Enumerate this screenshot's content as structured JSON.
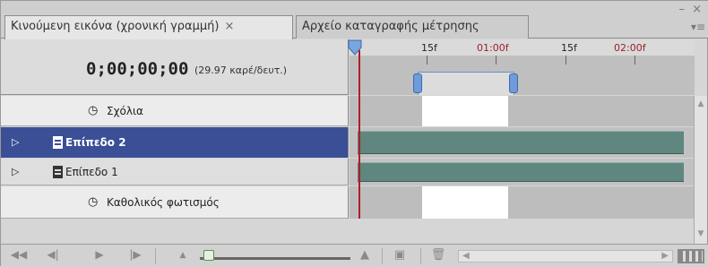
{
  "tabs": [
    {
      "label": "Κινούμενη εικόνα (χρονική γραμμή)",
      "close": "×"
    },
    {
      "label": "Αρχείο καταγραφής μέτρησης"
    }
  ],
  "window_controls": "– ×",
  "panel_menu": "▾≡",
  "header": {
    "timecode": "0;00;00;00",
    "fps": "(29.97 καρέ/δευτ.)"
  },
  "ruler": {
    "labels": [
      {
        "text": "15f",
        "type": "frames"
      },
      {
        "text": "01:00f",
        "type": "secs"
      },
      {
        "text": "15f",
        "type": "frames"
      },
      {
        "text": "02:00f",
        "type": "secs"
      }
    ]
  },
  "layers": [
    {
      "name": "Σχόλια",
      "kind": "global"
    },
    {
      "name": "Επίπεδο 2",
      "kind": "layer",
      "selected": true
    },
    {
      "name": "Επίπεδο 1",
      "kind": "layer"
    },
    {
      "name": "Καθολικός φωτισμός",
      "kind": "global"
    }
  ],
  "icons": {
    "expand": "disclosure-triangle",
    "film": "film-strip",
    "stopwatch": "stopwatch"
  },
  "colors": {
    "selected_row": "#3a4f96",
    "clip": "#5f877f",
    "playhead": "#b01d2a",
    "work_area": "#6f9bd9"
  },
  "footer": {
    "buttons": [
      "◀◀",
      "◀|",
      "▶",
      "|▶"
    ],
    "zoom_small": "▲",
    "zoom_large": "▲"
  }
}
